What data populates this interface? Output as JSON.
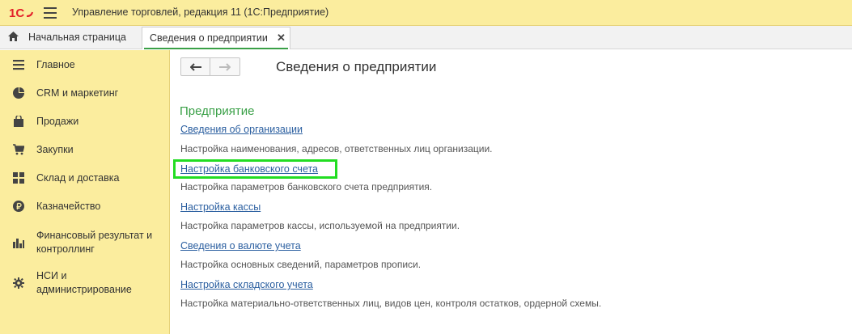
{
  "app": {
    "title": "Управление торговлей, редакция 11  (1С:Предприятие)",
    "logo_text": "1С",
    "brand_color": "#e3202a"
  },
  "tabs": {
    "home_label": "Начальная страница",
    "active_label": "Сведения о предприятии",
    "close_glyph": "✕"
  },
  "sidebar": {
    "items": [
      {
        "label": "Главное",
        "icon": "menu-lines-icon"
      },
      {
        "label": "CRM и маркетинг",
        "icon": "pie-chart-icon"
      },
      {
        "label": "Продажи",
        "icon": "shopping-bag-icon"
      },
      {
        "label": "Закупки",
        "icon": "cart-icon"
      },
      {
        "label": "Склад и доставка",
        "icon": "grid-icon"
      },
      {
        "label": "Казначейство",
        "icon": "ruble-coin-icon"
      },
      {
        "label": "Финансовый результат и\nконтроллинг",
        "icon": "bar-chart-icon"
      },
      {
        "label": "НСИ и\nадминистрирование",
        "icon": "gear-icon"
      }
    ]
  },
  "main": {
    "page_title": "Сведения о предприятии",
    "back_glyph": "🡐",
    "forward_glyph": "🡒",
    "section_title": "Предприятие",
    "section_color": "#3aa047",
    "entries": [
      {
        "link": "Сведения об организации",
        "desc": "Настройка наименования, адресов, ответственных лиц организации."
      },
      {
        "link": "Настройка банковского счета",
        "desc": "Настройка параметров банковского счета предприятия."
      },
      {
        "link": "Настройка кассы",
        "desc": "Настройка параметров кассы, используемой на предприятии."
      },
      {
        "link": "Сведения о валюте учета",
        "desc": "Настройка основных сведений, параметров прописи."
      },
      {
        "link": "Настройка складского учета",
        "desc": "Настройка материально-ответственных лиц, видов цен, контроля остатков, ордерной схемы."
      }
    ],
    "highlight_color": "#22dd22"
  }
}
